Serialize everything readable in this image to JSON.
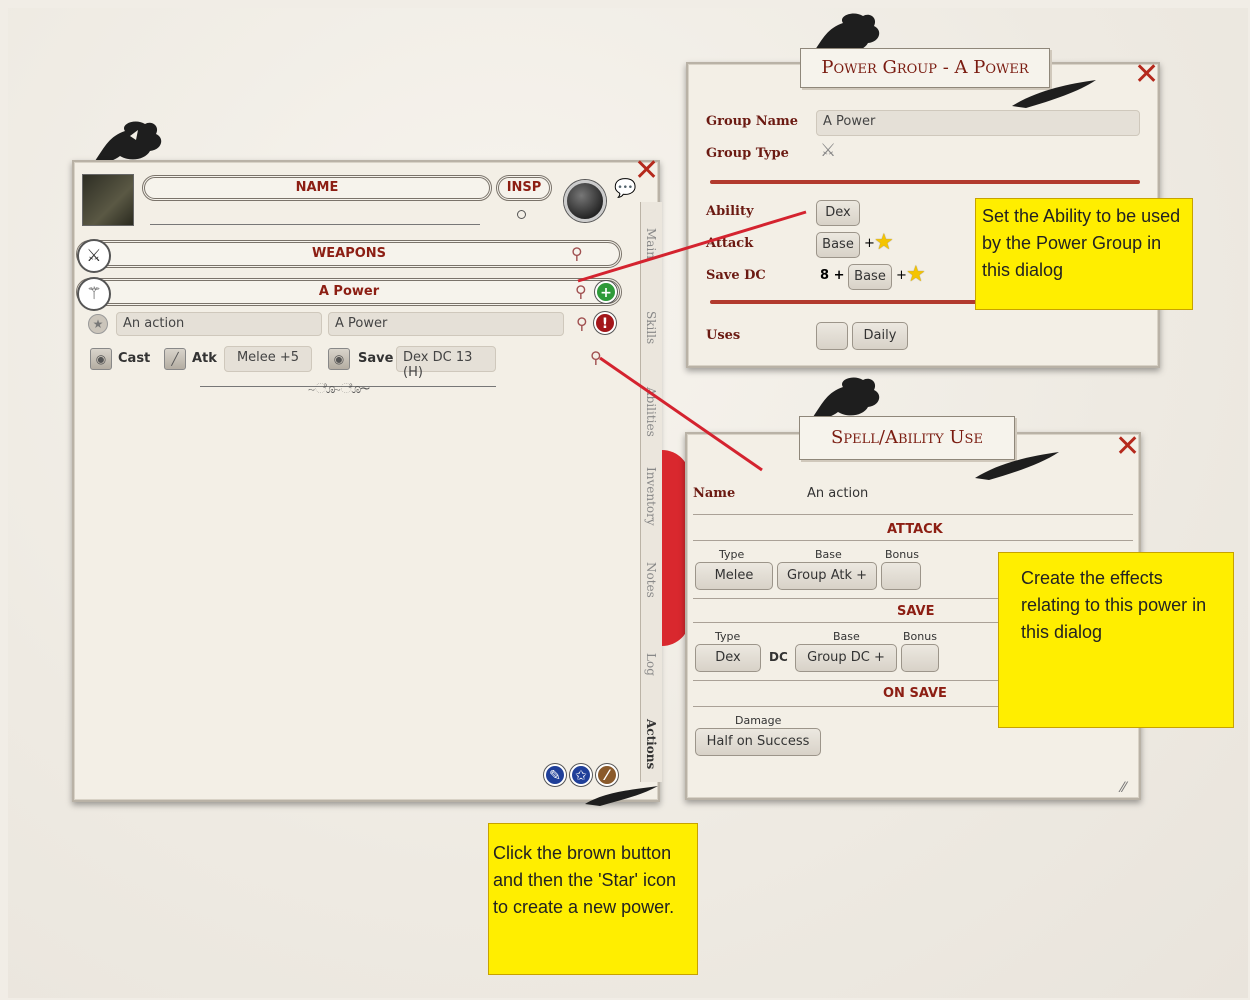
{
  "sheet": {
    "name_header": "NAME",
    "insp_header": "INSP",
    "weapons_header": "WEAPONS",
    "power_header": "A Power",
    "action_name": "An action",
    "action_group": "A Power",
    "cast_label": "Cast",
    "atk_label": "Atk",
    "atk_value": "Melee +5",
    "save_label": "Save",
    "save_value": "Dex DC 13 (H)",
    "tabs": [
      "Main",
      "Skills",
      "Abilities",
      "Inventory",
      "Notes",
      "Log",
      "Actions"
    ]
  },
  "power_group": {
    "title": "Power Group - A Power",
    "group_name_label": "Group Name",
    "group_name_value": "A Power",
    "group_type_label": "Group Type",
    "ability_label": "Ability",
    "ability_value": "Dex",
    "attack_label": "Attack",
    "attack_base": "Base",
    "save_dc_label": "Save DC",
    "save_dc_prefix": "8 +",
    "save_dc_base": "Base",
    "uses_label": "Uses",
    "uses_period": "Daily"
  },
  "spell_use": {
    "title": "Spell/Ability Use",
    "name_label": "Name",
    "name_value": "An action",
    "attack_header": "ATTACK",
    "atk_type_label": "Type",
    "atk_base_label": "Base",
    "atk_bonus_label": "Bonus",
    "atk_type_value": "Melee",
    "atk_base_value": "Group Atk +",
    "save_header": "SAVE",
    "save_type_label": "Type",
    "save_base_label": "Base",
    "save_bonus_label": "Bonus",
    "save_type_value": "Dex",
    "save_dc_text": "DC",
    "save_base_value": "Group DC +",
    "onsave_header": "ON SAVE",
    "damage_label": "Damage",
    "damage_value": "Half on Success"
  },
  "callouts": {
    "ability": "Set the Ability to be used by the Power Group in this dialog",
    "effects": "Create the effects relating to this power in this dialog",
    "new_power": "Click the brown button and then the 'Star' icon to create a new power."
  },
  "colors": {
    "callout": "#ffee00",
    "accent_red": "#b5291c",
    "pointer_line": "#d4232f",
    "button_green": "#2e9a3a",
    "button_brown": "#8a5a2b",
    "button_blue": "#1f3f99"
  }
}
